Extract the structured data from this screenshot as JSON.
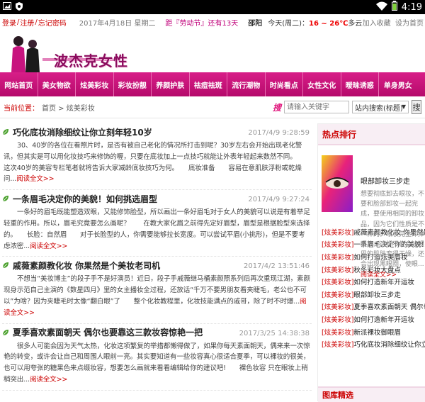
{
  "status_bar": {
    "time": "4:19"
  },
  "topbar": {
    "login": "登录",
    "register": "注册",
    "forgot": "忘记密码",
    "sep": "/",
    "date": "2017年4月18日 星期二",
    "holiday": "距『劳动节』还有13天",
    "city": "邵阳",
    "weather_prefix": "今天(周二)：",
    "temp": "16 ~ 26℃",
    "weather": "多云",
    "favorite": "加入收藏",
    "homepage": "设为首页"
  },
  "logo": {
    "text": "波杰克女性"
  },
  "nav": [
    "网站首页",
    "美女物欲",
    "炫美彩妆",
    "彩妆扮靓",
    "养颜护肤",
    "祛痘祛斑",
    "流行潮物",
    "时尚看点",
    "女性文化",
    "暧昧诱惑",
    "单身男女"
  ],
  "breadcrumb": {
    "label": "当前位置：",
    "path": "首页 > 炫美彩妆"
  },
  "search": {
    "logo": "搜",
    "placeholder": "请输入关键字",
    "scope": "站内搜索(标题)",
    "button": "搜"
  },
  "articles": [
    {
      "title": "巧化底妆消除细纹让你立刻年轻10岁",
      "date": "2017/4/9 9:28:59",
      "summary": "30、40岁的各位在看照片时，是否有被自己老化的情况所打击到呢？30岁左右会开始出现老化警讯，但其实是可以用化妆技巧来修饰的喔，只要在底妆加上一点技巧就能让外表年轻起来数然不同。　　这次40岁的美容专栏笔者就将告诉大家减龄底妆技巧为何。　　底妆准备　　容易在意肌肤浮粉或乾燥问...",
      "more": "阅读全文>>"
    },
    {
      "title": "一条眉毛决定你的美貌！如何挑选眉型",
      "date": "2017/4/9 9:27:24",
      "summary": "一条好的眉毛既能塑造双眼，又能修饰脸型，所以画出一条好眉毛对于女人的美貌可以说是有着举足轻重的作用。所以，眉毛究竟要怎么画呢？　　在教大家化眉之前得先定好眉型，眉型是根据脸型来选择的。　　长脸：自然眉　　对于长脸型的人，你需要能够拉长宽度。可以尝试平眉(小挑形)，但是不要考虑浓密...",
      "more": "阅读全文>>"
    },
    {
      "title": "戚薇素颜教化妆 你果然是个美妆老司机",
      "date": "2017/4/2 13:51:46",
      "summary": "不想当“美妆博主”的段子手不是好演员！近日，段子手戚薇继马桶素颜照系列后再次重现江湖，素颜现身示范自己主演的《数星四月》里的女主播妆全过程，还放话“千万不要男朋友看夹睫毛，老公也不可以”为啥？因为夹睫毛时太像“翻白眼”了　　整个化妆教程里，化妆技能满点的戚哥，除了时不时爆...",
      "more": "阅读全文>>"
    },
    {
      "title": "夏季喜欢素面朝天 偶尔也要靠这三款妆容惊艳一把",
      "date": "2017/3/25 14:38:38",
      "summary": "很多人可能会因为天气太热，化妆这项繁复的举措都懒得做了，如果你每天素面朝天，偶来来一次惊艳的转变，或许会让自己和周围人眼前一亮。其实要知道有一些妆容真心很适合夏季，可以裸妆的很美，也可以用夸张的糖果色来点缀妆容，想要怎么画就来看看编辑给你的建议吧!　　裸色妆容 只在眼妆上稍稍突出...",
      "more": "阅读全文>>"
    }
  ],
  "sidebar": {
    "title": "热点排行",
    "featured": {
      "title": "眼部卸妆三步走",
      "summary": "想要彻底卸去眼妆，不要和脸部卸妆一起完成，要使用相同的卸妆品，因为它们性质是不一样的。眼妆完全卸掉眼妆，这样不仅会让眼周的肌肤变得干燥，还会出现黑眼圈，使眼...",
      "more": "阅读全文>>"
    },
    "list": [
      {
        "cat": "[炫美彩妆]",
        "title": "戚薇素颜教化妆 你果然是个美妆老司机"
      },
      {
        "cat": "[炫美彩妆]",
        "title": "一条眉毛决定你的美貌！如何挑选眉型"
      },
      {
        "cat": "[炫美彩妆]",
        "title": "如何打造炫美唇妆"
      },
      {
        "cat": "[炫美彩妆]",
        "title": "秋冬彩妆大盘点"
      },
      {
        "cat": "[炫美彩妆]",
        "title": "如何打造新年开运妆"
      },
      {
        "cat": "[炫美彩妆]",
        "title": "眼部卸妆三步走"
      },
      {
        "cat": "[炫美彩妆]",
        "title": "夏季喜欢素面朝天 偶尔也要靠这"
      },
      {
        "cat": "[炫美彩妆]",
        "title": "如何打造新年开运妆"
      },
      {
        "cat": "[炫美彩妆]",
        "title": "新派裸妆御眼眉"
      },
      {
        "cat": "[炫美彩妆]",
        "title": "巧化底妆消除细纹让你立刻年轻10岁"
      }
    ],
    "gallery_title": "图库精选"
  }
}
